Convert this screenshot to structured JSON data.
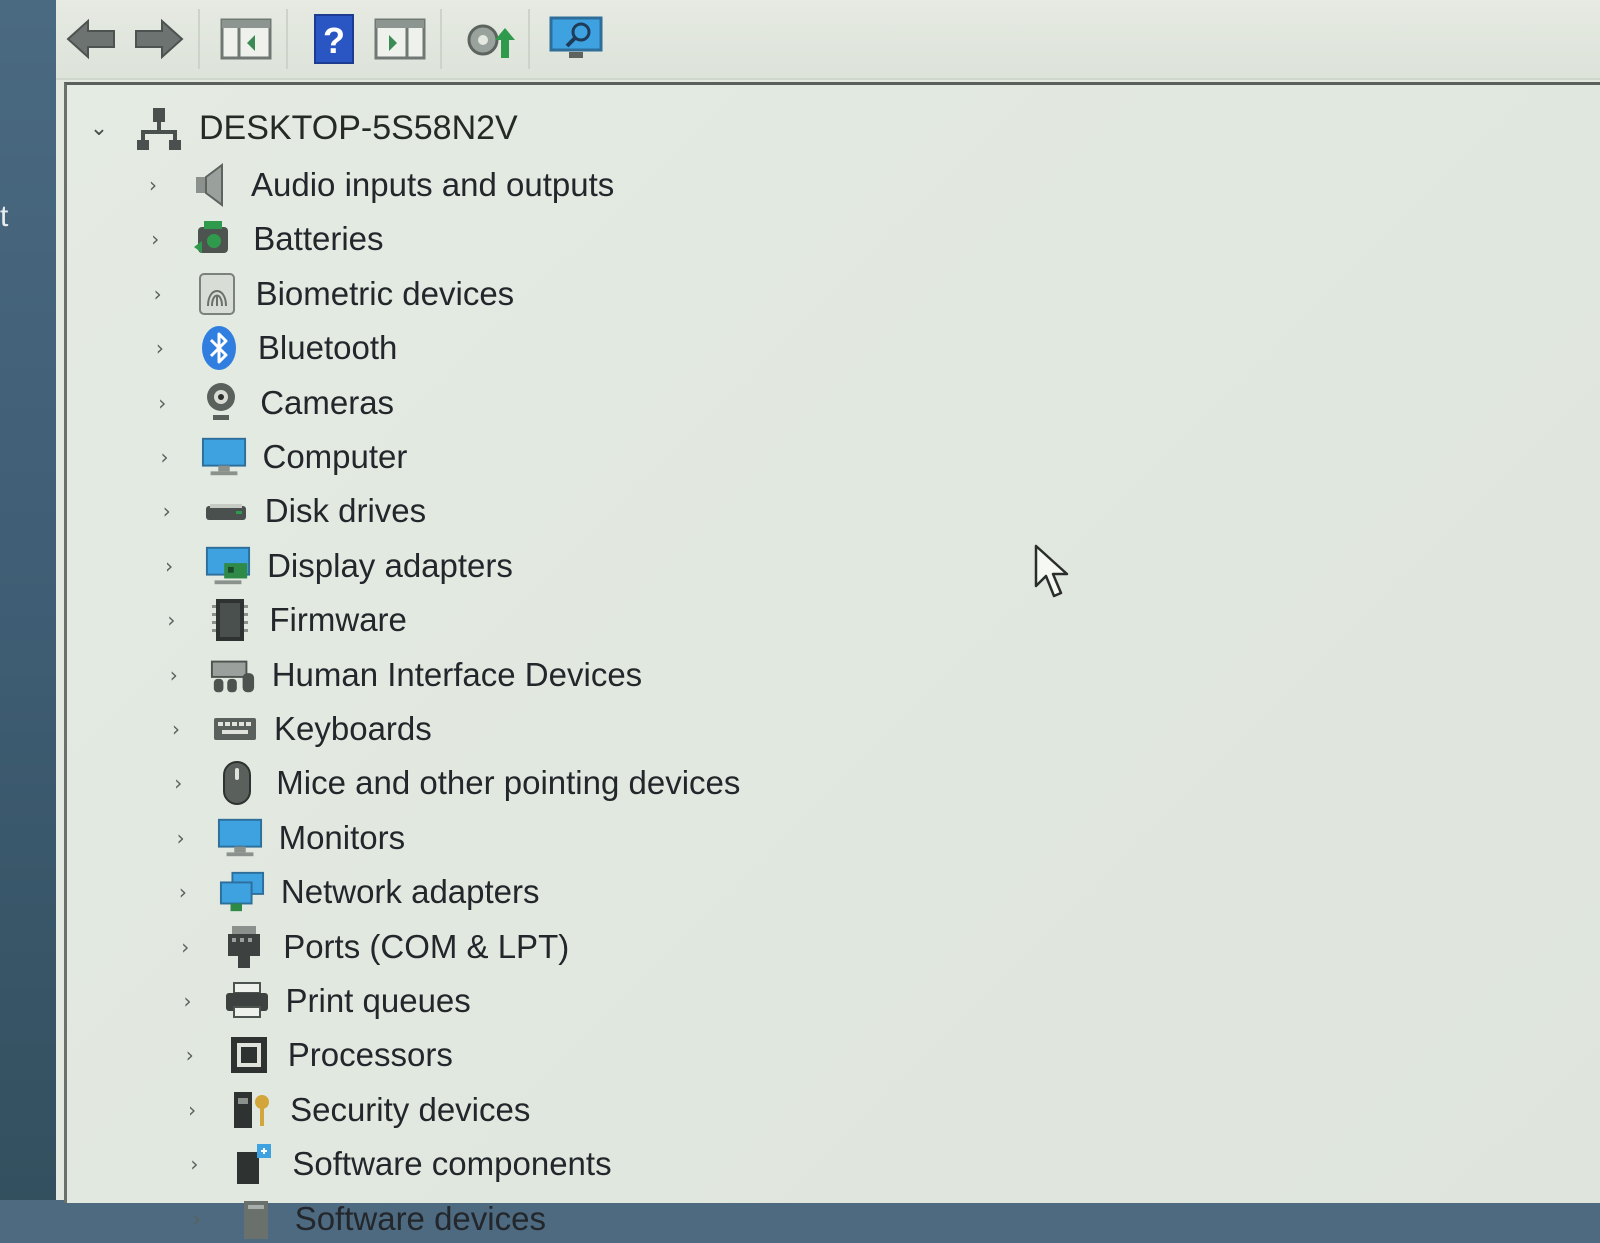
{
  "desktop": {
    "edge_letter": "t"
  },
  "toolbar": {
    "buttons": [
      {
        "name": "back-arrow-icon"
      },
      {
        "name": "forward-arrow-icon"
      },
      {
        "name": "show-hide-console-tree-icon"
      },
      {
        "name": "help-icon"
      },
      {
        "name": "show-action-pane-icon"
      },
      {
        "name": "update-driver-icon"
      },
      {
        "name": "scan-hardware-changes-icon"
      }
    ]
  },
  "tree": {
    "root": {
      "label": "DESKTOP-5S58N2V",
      "icon": "computer-network-icon",
      "expanded": true
    },
    "items": [
      {
        "label": "Audio inputs and outputs",
        "icon": "speaker-icon"
      },
      {
        "label": "Batteries",
        "icon": "battery-icon"
      },
      {
        "label": "Biometric devices",
        "icon": "fingerprint-icon"
      },
      {
        "label": "Bluetooth",
        "icon": "bluetooth-icon"
      },
      {
        "label": "Cameras",
        "icon": "webcam-icon"
      },
      {
        "label": "Computer",
        "icon": "monitor-icon"
      },
      {
        "label": "Disk drives",
        "icon": "disk-drive-icon"
      },
      {
        "label": "Display adapters",
        "icon": "display-adapter-icon"
      },
      {
        "label": "Firmware",
        "icon": "chip-icon"
      },
      {
        "label": "Human Interface Devices",
        "icon": "hid-icon"
      },
      {
        "label": "Keyboards",
        "icon": "keyboard-icon"
      },
      {
        "label": "Mice and other pointing devices",
        "icon": "mouse-icon"
      },
      {
        "label": "Monitors",
        "icon": "monitor-icon"
      },
      {
        "label": "Network adapters",
        "icon": "network-adapter-icon"
      },
      {
        "label": "Ports (COM & LPT)",
        "icon": "port-icon"
      },
      {
        "label": "Print queues",
        "icon": "printer-icon"
      },
      {
        "label": "Processors",
        "icon": "processor-icon"
      },
      {
        "label": "Security devices",
        "icon": "security-device-icon"
      },
      {
        "label": "Software components",
        "icon": "software-component-icon"
      },
      {
        "label": "Software devices",
        "icon": "software-device-icon"
      }
    ]
  },
  "colors": {
    "bluetooth": "#2f7ee0",
    "monitor": "#3fa2e0",
    "help": "#2a56c4"
  }
}
